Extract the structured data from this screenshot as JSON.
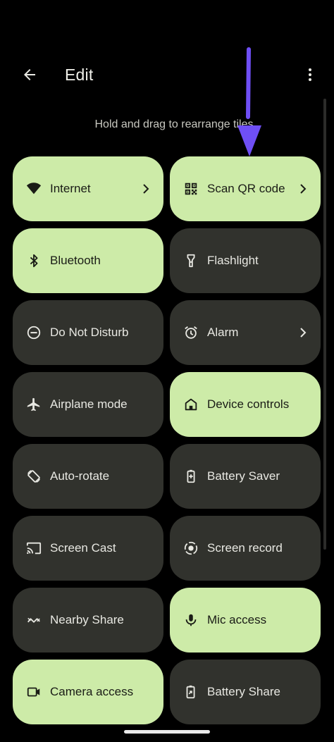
{
  "header": {
    "title": "Edit",
    "back_icon": "arrow-back-icon",
    "more_icon": "more-vert-icon"
  },
  "hint": "Hold and drag to rearrange tiles",
  "tiles": [
    {
      "label": "Internet",
      "icon": "wifi-icon",
      "state": "on",
      "chevron": true
    },
    {
      "label": "Scan QR code",
      "icon": "qr-code-icon",
      "state": "on",
      "chevron": true
    },
    {
      "label": "Bluetooth",
      "icon": "bluetooth-icon",
      "state": "on",
      "chevron": false
    },
    {
      "label": "Flashlight",
      "icon": "flashlight-icon",
      "state": "off",
      "chevron": false
    },
    {
      "label": "Do Not Disturb",
      "icon": "do-not-disturb-icon",
      "state": "off",
      "chevron": false
    },
    {
      "label": "Alarm",
      "icon": "alarm-icon",
      "state": "off",
      "chevron": true
    },
    {
      "label": "Airplane mode",
      "icon": "airplane-icon",
      "state": "off",
      "chevron": false
    },
    {
      "label": "Device controls",
      "icon": "home-icon",
      "state": "on",
      "chevron": false
    },
    {
      "label": "Auto-rotate",
      "icon": "auto-rotate-icon",
      "state": "off",
      "chevron": false
    },
    {
      "label": "Battery Saver",
      "icon": "battery-saver-icon",
      "state": "off",
      "chevron": false
    },
    {
      "label": "Screen Cast",
      "icon": "cast-icon",
      "state": "off",
      "chevron": false
    },
    {
      "label": "Screen record",
      "icon": "screen-record-icon",
      "state": "off",
      "chevron": false
    },
    {
      "label": "Nearby Share",
      "icon": "nearby-share-icon",
      "state": "off",
      "chevron": false
    },
    {
      "label": "Mic access",
      "icon": "mic-icon",
      "state": "on",
      "chevron": false
    },
    {
      "label": "Camera access",
      "icon": "camera-icon",
      "state": "on",
      "chevron": false
    },
    {
      "label": "Battery Share",
      "icon": "battery-share-icon",
      "state": "off",
      "chevron": false
    }
  ],
  "colors": {
    "background": "#000000",
    "tile_on": "#cdeba8",
    "tile_off": "#31322d",
    "annotation_arrow": "#6f4ff5"
  }
}
